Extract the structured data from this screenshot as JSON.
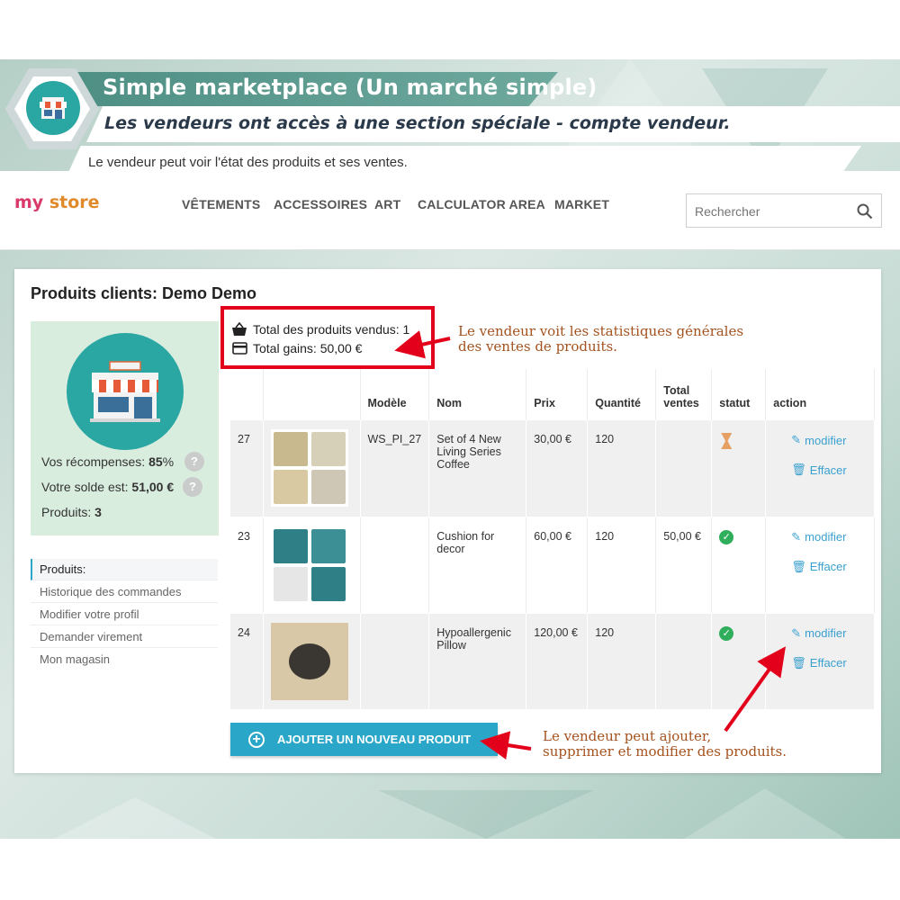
{
  "banner": {
    "title": "Simple marketplace (Un marché simple)",
    "subtitle": "Les vendeurs ont accès à une section spéciale - compte vendeur.",
    "description": "Le vendeur peut voir l'état des produits et ses ventes."
  },
  "store": {
    "logo_part1": "my",
    "logo_part2": "store",
    "nav": [
      "VÊTEMENTS",
      "ACCESSOIRES",
      "ART",
      "CALCULATOR AREA",
      "MARKET"
    ],
    "search_placeholder": "Rechercher"
  },
  "page": {
    "title": "Produits clients: Demo Demo"
  },
  "profile": {
    "rewards_label": "Vos récompenses:",
    "rewards_value": "85",
    "rewards_unit": "%",
    "balance_label": "Votre solde est:",
    "balance_value": "51,00 €",
    "products_label": "Produits:",
    "products_value": "3",
    "help": "?"
  },
  "side_menu": [
    "Produits:",
    "Historique des commandes",
    "Modifier votre profil",
    "Demander virement",
    "Mon magasin"
  ],
  "stats": {
    "total_sold": "Total des produits vendus: 1",
    "total_earnings": "Total gains: 50,00 €"
  },
  "callouts": {
    "stats_line1": "Le vendeur voit les statistiques générales",
    "stats_line2": "des ventes de produits.",
    "actions_line1": "Le vendeur peut ajouter,",
    "actions_line2": "supprimer et modifier des produits."
  },
  "table": {
    "headers": {
      "model": "Modèle",
      "name": "Nom",
      "price": "Prix",
      "quantity": "Quantité",
      "total_sales_line1": "Total",
      "total_sales_line2": "ventes",
      "status": "statut",
      "action": "action"
    },
    "rows": [
      {
        "id": "27",
        "model": "WS_PI_27",
        "name": "Set of 4 New Living Series Coffee",
        "price": "30,00 €",
        "quantity": "120",
        "total_sales": "",
        "status": "pending"
      },
      {
        "id": "23",
        "model": "",
        "name": "Cushion for decor",
        "price": "60,00 €",
        "quantity": "120",
        "total_sales": "50,00 €",
        "status": "active"
      },
      {
        "id": "24",
        "model": "",
        "name": "Hypoallergenic Pillow",
        "price": "120,00 €",
        "quantity": "120",
        "total_sales": "",
        "status": "active"
      }
    ],
    "edit_label": "modifier",
    "delete_label": "Effacer"
  },
  "add_button": "AJOUTER UN NOUVEAU PRODUIT",
  "colors": {
    "teal": "#2aa6a3",
    "link": "#3aa0cf",
    "button": "#2aa6c8",
    "highlight_red": "#e3001b",
    "callout_text": "#a4521e",
    "status_ok": "#2fae5b",
    "status_pending": "#e6a064"
  }
}
